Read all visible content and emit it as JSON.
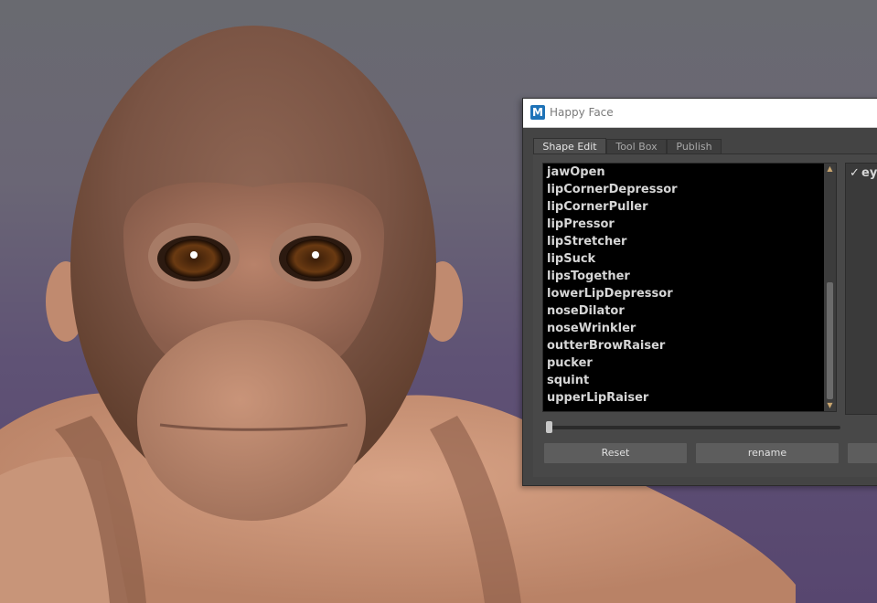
{
  "window": {
    "title": "Happy Face",
    "logo_letter": "M"
  },
  "tabs": [
    {
      "label": "Shape Edit",
      "active": true
    },
    {
      "label": "Tool Box",
      "active": false
    },
    {
      "label": "Publish",
      "active": false
    }
  ],
  "shape_list": {
    "items": [
      "jawOpen",
      "lipCornerDepressor",
      "lipCornerPuller",
      "lipPressor",
      "lipStretcher",
      "lipSuck",
      "lipsTogether",
      "lowerLipDepressor",
      "noseDilator",
      "noseWrinkler",
      "outterBrowRaiser",
      "pucker",
      "squint",
      "upperLipRaiser"
    ]
  },
  "right_panel": {
    "check_icon": "checkmark-icon",
    "label": "ey"
  },
  "slider": {
    "value": 0
  },
  "buttons": {
    "reset": "Reset",
    "rename": "rename",
    "third": ""
  },
  "colors": {
    "window_bg": "#444444",
    "list_bg": "#000000",
    "list_text": "#d6d6d6",
    "button_bg": "#5d5d5d"
  }
}
